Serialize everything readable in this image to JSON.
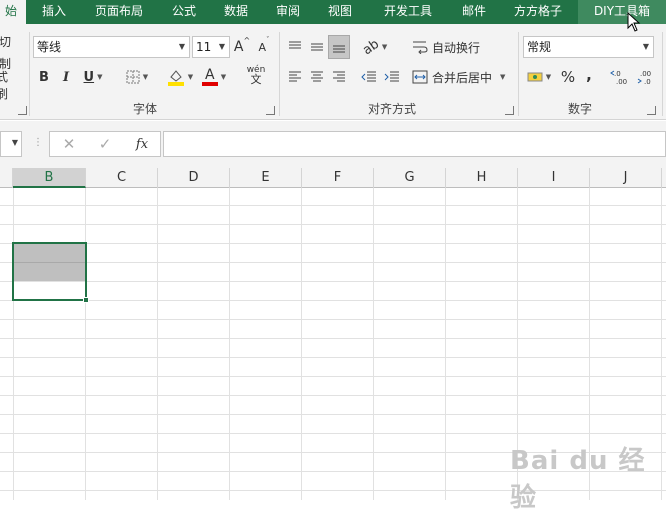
{
  "ribbon": {
    "tabs": [
      {
        "label": "始",
        "state": "active"
      },
      {
        "label": "插入"
      },
      {
        "label": "页面布局"
      },
      {
        "label": "公式"
      },
      {
        "label": "数据"
      },
      {
        "label": "审阅"
      },
      {
        "label": "视图"
      },
      {
        "label": "开发工具"
      },
      {
        "label": "邮件"
      },
      {
        "label": "方方格子"
      },
      {
        "label": "DIY工具箱",
        "state": "hover"
      }
    ],
    "clipboard": {
      "cut_fragment": "切",
      "copy_fragment": "制",
      "format_painter_fragment": "式刷"
    },
    "font": {
      "font_name": "等线",
      "font_size": "11",
      "grow_label": "A",
      "shrink_label": "A",
      "bold": "B",
      "italic": "I",
      "underline": "U",
      "font_color_letter": "A",
      "phonetic_top": "wén",
      "phonetic_bottom": "文",
      "group_label": "字体",
      "fill_color": "#ffe000",
      "font_color": "#e00000"
    },
    "alignment": {
      "wrap_text": "自动换行",
      "merge_center": "合并后居中",
      "group_label": "对齐方式"
    },
    "number": {
      "format": "常规",
      "percent": "%",
      "comma": ",",
      "group_label": "数字"
    }
  },
  "formula_bar": {
    "fx": "fx",
    "cancel": "✕",
    "enter": "✓",
    "value": ""
  },
  "sheet": {
    "columns": [
      "B",
      "C",
      "D",
      "E",
      "F",
      "G",
      "H",
      "I",
      "J"
    ],
    "selected_column": "B",
    "accent": "#217346"
  },
  "watermark": "Bai du 经验"
}
